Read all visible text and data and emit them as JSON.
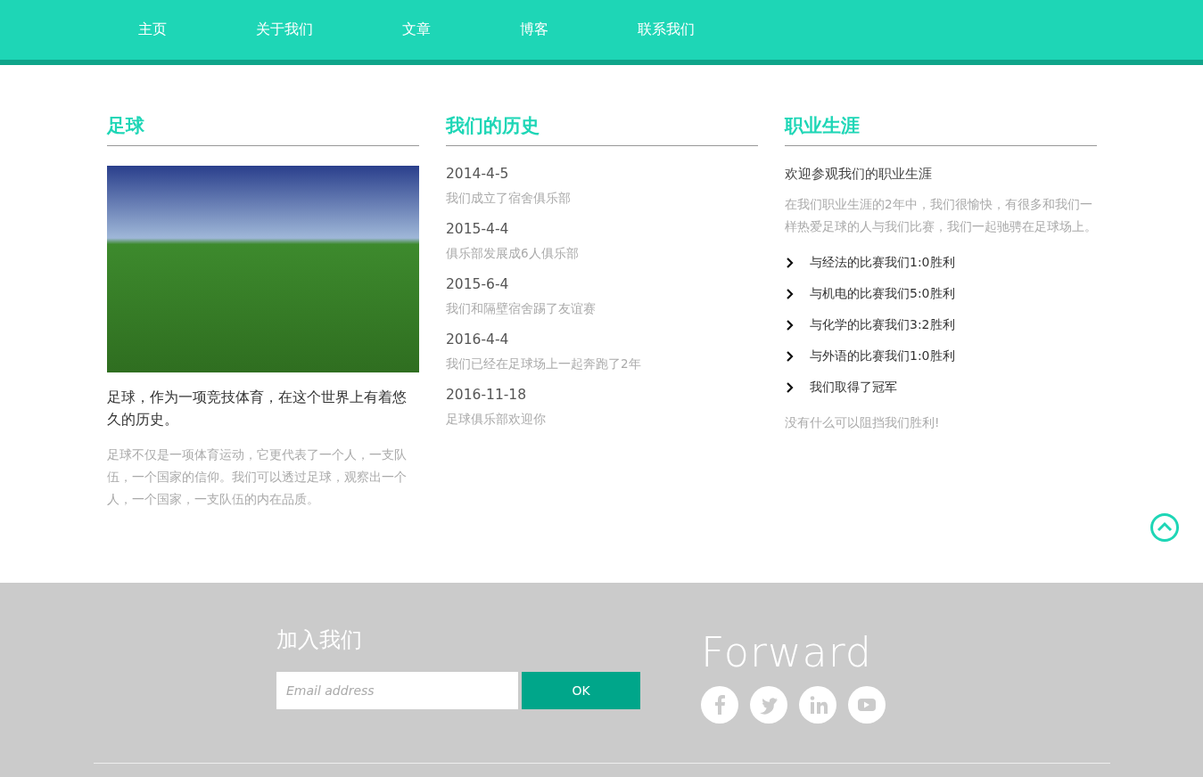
{
  "nav": {
    "items": [
      {
        "label": "主页"
      },
      {
        "label": "关于我们"
      },
      {
        "label": "文章"
      },
      {
        "label": "博客"
      },
      {
        "label": "联系我们"
      }
    ]
  },
  "football": {
    "heading": "足球",
    "lead": "足球，作为一项竞技体育，在这个世界上有着悠久的历史。",
    "text": "足球不仅是一项体育运动，它更代表了一个人，一支队伍，一个国家的信仰。我们可以透过足球，观察出一个人，一个国家，一支队伍的内在品质。"
  },
  "history": {
    "heading": "我们的历史",
    "events": [
      {
        "date": "2014-4-5",
        "text": "我们成立了宿舍俱乐部"
      },
      {
        "date": "2015-4-4",
        "text": "俱乐部发展成6人俱乐部"
      },
      {
        "date": "2015-6-4",
        "text": "我们和隔壁宿舍踢了友谊赛"
      },
      {
        "date": "2016-4-4",
        "text": "我们已经在足球场上一起奔跑了2年"
      },
      {
        "date": "2016-11-18",
        "text": "足球俱乐部欢迎你"
      }
    ]
  },
  "career": {
    "heading": "职业生涯",
    "subtitle": "欢迎参观我们的职业生涯",
    "intro": "在我们职业生涯的2年中，我们很愉快，有很多和我们一样热爱足球的人与我们比赛，我们一起驰骋在足球场上。",
    "items": [
      "与经法的比赛我们1:0胜利",
      "与机电的比赛我们5:0胜利",
      "与化学的比赛我们3:2胜利",
      "与外语的比赛我们1:0胜利",
      "我们取得了冠军"
    ],
    "closing": "没有什么可以阻挡我们胜利!"
  },
  "footer": {
    "join_heading": "加入我们",
    "email_placeholder": "Email address",
    "submit": "OK",
    "brand": "Forward",
    "social": [
      {
        "kind": "facebook"
      },
      {
        "kind": "twitter"
      },
      {
        "kind": "linkedin"
      },
      {
        "kind": "youtube"
      }
    ]
  }
}
